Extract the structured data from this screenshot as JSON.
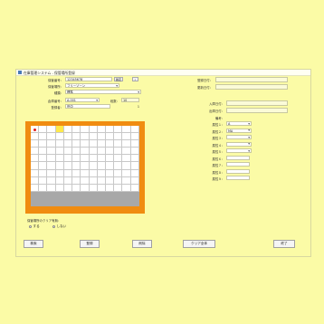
{
  "window": {
    "title": "在庫管理システム - 保管場所登録"
  },
  "form_left": {
    "storage_no_label": "保管番号：",
    "storage_no_value": "12345678",
    "storage_confirm_button": "確定",
    "location_label": "保管場所：",
    "location_value": "フリーゾーン",
    "type_label": "種類：",
    "type_value": "標準",
    "warehouse_no_label": "倉庫番号：",
    "warehouse_no_value": "A-001",
    "shelf_count_label": "段数：",
    "shelf_count_value": "10",
    "registrant_label": "登録者：",
    "registrant_value": "田中",
    "registrant_extra": "1"
  },
  "form_right": {
    "date_label": "登録日付：",
    "update_label": "更新日付：",
    "date_value": "",
    "update_value": "",
    "in_date_label": "入庫日付：",
    "in_date_value": "",
    "out_date_label": "出庫日付：",
    "out_date_value": "",
    "memo_label": "備考：",
    "attr_labels": [
      "属性１：",
      "属性２：",
      "属性３：",
      "属性４：",
      "属性５：",
      "属性６：",
      "属性７：",
      "属性８：",
      "属性９："
    ],
    "attr_values": [
      "A",
      "MA",
      "",
      "",
      "",
      "",
      "",
      "",
      ""
    ]
  },
  "grid": {
    "cols": 13,
    "rows": 11,
    "filled_rows": 2,
    "highlight": {
      "row": 0,
      "col": 3
    },
    "marker": {
      "row": 0,
      "col": 0
    }
  },
  "radio": {
    "question": "保管場所のクリア有無：",
    "opt1": "する",
    "opt2": "しない"
  },
  "buttons": {
    "search": "検索",
    "register": "登録",
    "delete": "削除",
    "clear_all": "クリア全体",
    "close": "終了"
  },
  "colors": {
    "background": "#fbfba6",
    "grid_frame": "#f08c10",
    "highlight": "#ffe94a",
    "marker": "#e02020"
  }
}
